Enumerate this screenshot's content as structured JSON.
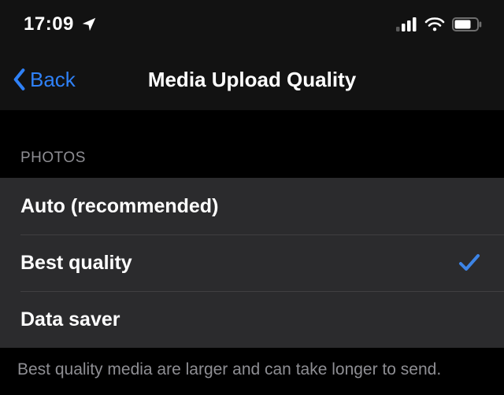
{
  "status": {
    "time": "17:09"
  },
  "nav": {
    "back_label": "Back",
    "title": "Media Upload Quality"
  },
  "section": {
    "label": "PHOTOS"
  },
  "options": {
    "auto": "Auto (recommended)",
    "best": "Best quality",
    "saver": "Data saver",
    "selected": "best"
  },
  "footer": {
    "note": "Best quality media are larger and can take longer to send."
  },
  "colors": {
    "accent": "#2f81f7"
  }
}
